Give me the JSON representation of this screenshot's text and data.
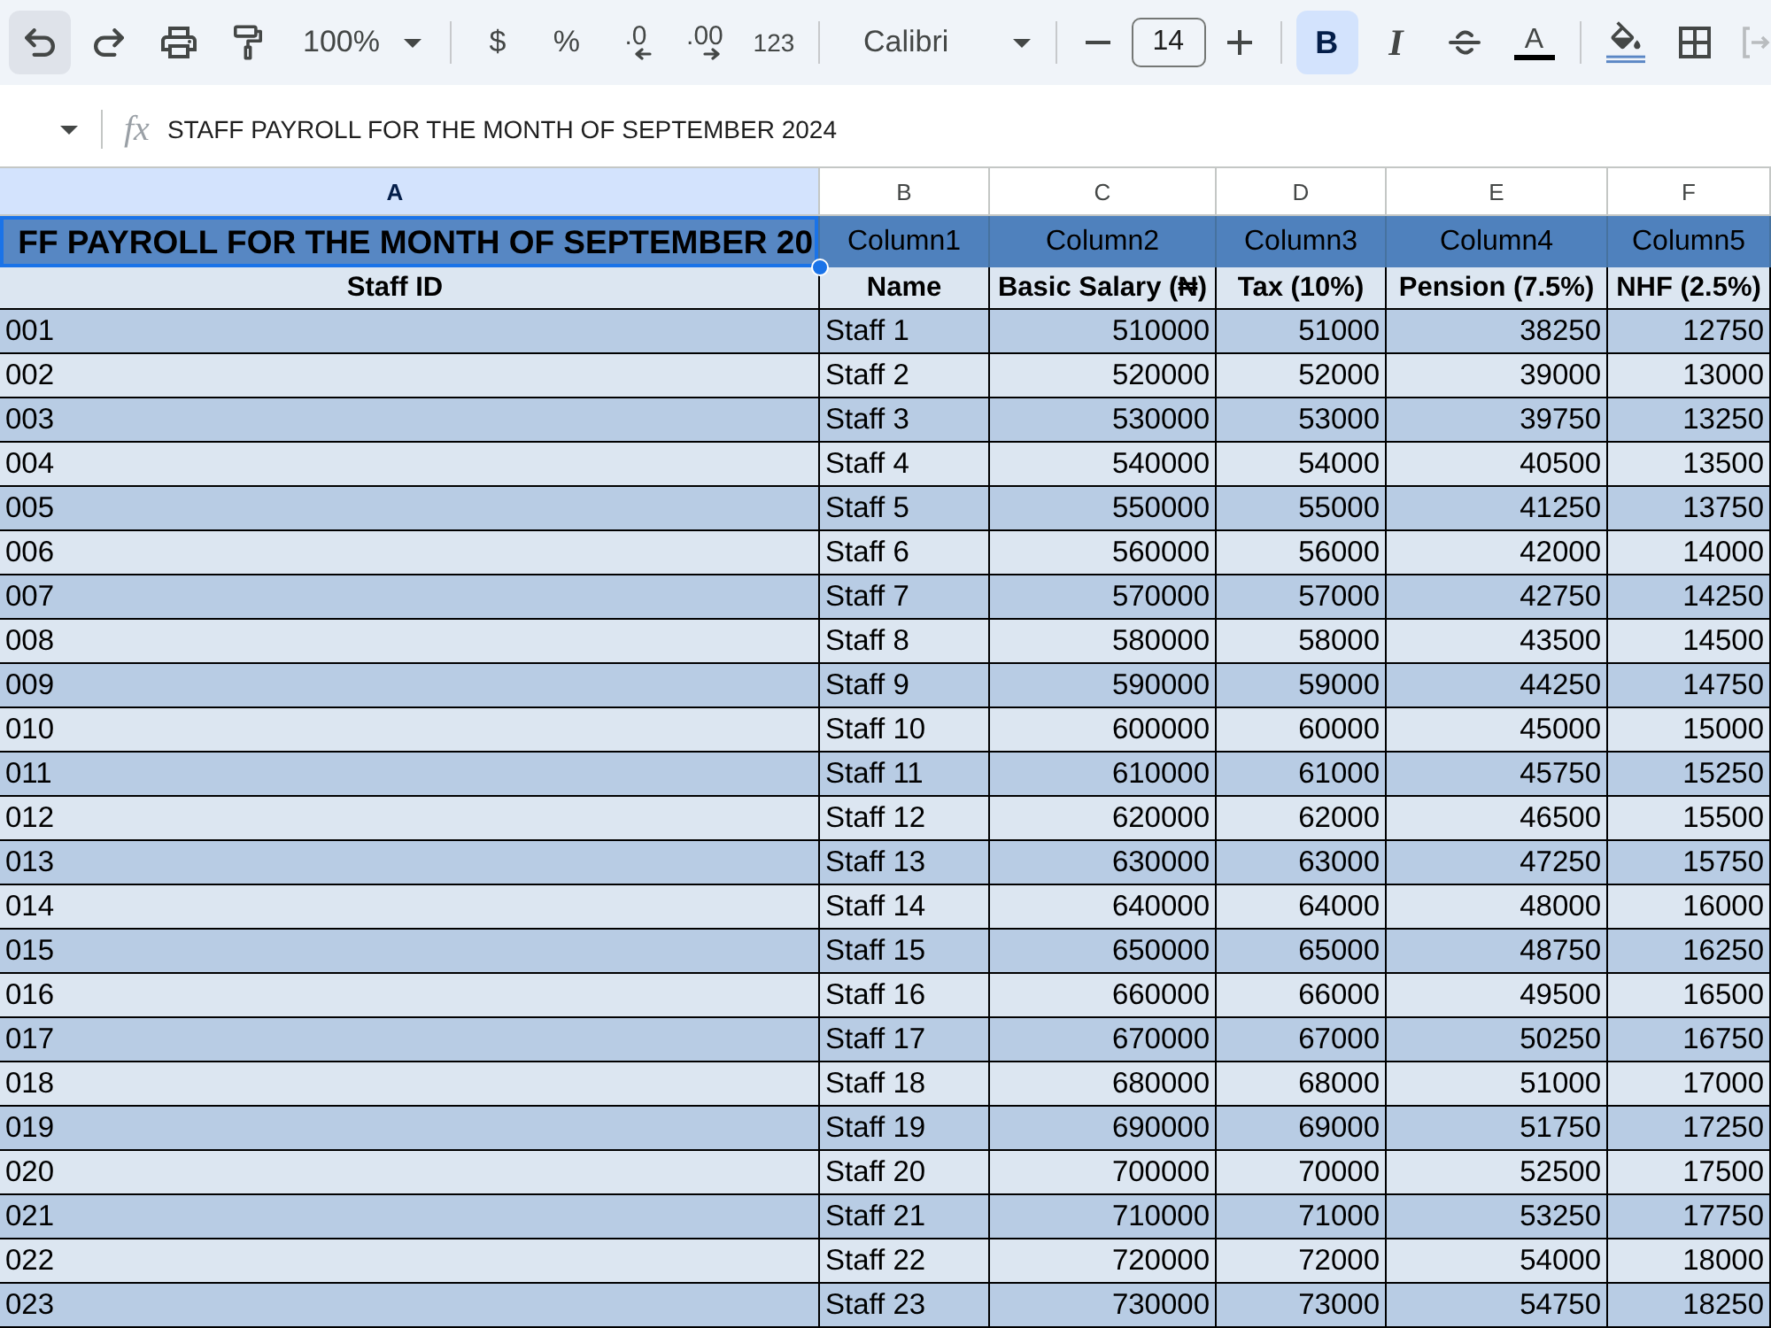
{
  "toolbar": {
    "groups": [
      {
        "items": [
          {
            "kind": "undo",
            "hovered": true
          },
          {
            "kind": "redo",
            "hovered": false
          },
          {
            "kind": "print",
            "hovered": false
          },
          {
            "kind": "paint_format",
            "hovered": false
          },
          {
            "kind": "zoom",
            "label": "100%",
            "hovered": false
          }
        ]
      },
      {
        "items": [
          {
            "kind": "currency",
            "label": "$",
            "hovered": false
          },
          {
            "kind": "percent",
            "label": "%",
            "hovered": false
          },
          {
            "kind": "decimal_decrease",
            "label": ".0",
            "hovered": false
          },
          {
            "kind": "decimal_increase",
            "label": ".00",
            "hovered": false
          },
          {
            "kind": "number_format",
            "label": "123",
            "hovered": false
          }
        ]
      },
      {
        "items": [
          {
            "kind": "font",
            "label": "Calibri",
            "hovered": false
          }
        ]
      },
      {
        "items": [
          {
            "kind": "size_decrease",
            "hovered": false
          },
          {
            "kind": "font_size",
            "value": "14",
            "hovered": false
          },
          {
            "kind": "size_increase",
            "hovered": false
          }
        ]
      },
      {
        "items": [
          {
            "kind": "bold",
            "label": "B",
            "hovered": false,
            "pressed": true
          },
          {
            "kind": "italic",
            "label": "I",
            "hovered": false,
            "pressed": false
          },
          {
            "kind": "strikethrough",
            "hovered": false,
            "pressed": false
          },
          {
            "kind": "text_color",
            "label": "A",
            "hovered": false,
            "pressed": false
          }
        ]
      },
      {
        "items": [
          {
            "kind": "fill_color",
            "hovered": false
          },
          {
            "kind": "borders",
            "hovered": false
          },
          {
            "kind": "merge",
            "hovered": false
          }
        ]
      }
    ]
  },
  "formula_bar": {
    "label": "fx",
    "formula": "STAFF PAYROLL FOR THE MONTH OF SEPTEMBER 2024"
  },
  "sheet": {
    "columns": [
      {
        "letter": "A",
        "selected": true
      },
      {
        "letter": "B",
        "selected": false
      },
      {
        "letter": "C",
        "selected": false
      },
      {
        "letter": "D",
        "selected": false
      },
      {
        "letter": "E",
        "selected": false
      },
      {
        "letter": "F",
        "selected": false
      }
    ],
    "title_row": [
      {
        "kind": "title",
        "text": "FF PAYROLL FOR THE MONTH OF SEPTEMBER 20",
        "selected": true
      },
      {
        "kind": "name",
        "text": "Column1",
        "selected": false
      },
      {
        "kind": "name",
        "text": "Column2",
        "selected": false
      },
      {
        "kind": "name",
        "text": "Column3",
        "selected": false
      },
      {
        "kind": "name",
        "text": "Column4",
        "selected": false
      },
      {
        "kind": "name",
        "text": "Column5",
        "selected": false
      }
    ],
    "header_row": [
      "Staff ID",
      "Name",
      "Basic Salary (₦)",
      "Tax (10%)",
      "Pension (7.5%)",
      "NHF (2.5%)"
    ],
    "rows": [
      [
        "001",
        "Staff 1",
        "510000",
        "51000",
        "38250",
        "12750"
      ],
      [
        "002",
        "Staff 2",
        "520000",
        "52000",
        "39000",
        "13000"
      ],
      [
        "003",
        "Staff 3",
        "530000",
        "53000",
        "39750",
        "13250"
      ],
      [
        "004",
        "Staff 4",
        "540000",
        "54000",
        "40500",
        "13500"
      ],
      [
        "005",
        "Staff 5",
        "550000",
        "55000",
        "41250",
        "13750"
      ],
      [
        "006",
        "Staff 6",
        "560000",
        "56000",
        "42000",
        "14000"
      ],
      [
        "007",
        "Staff 7",
        "570000",
        "57000",
        "42750",
        "14250"
      ],
      [
        "008",
        "Staff 8",
        "580000",
        "58000",
        "43500",
        "14500"
      ],
      [
        "009",
        "Staff 9",
        "590000",
        "59000",
        "44250",
        "14750"
      ],
      [
        "010",
        "Staff 10",
        "600000",
        "60000",
        "45000",
        "15000"
      ],
      [
        "011",
        "Staff 11",
        "610000",
        "61000",
        "45750",
        "15250"
      ],
      [
        "012",
        "Staff 12",
        "620000",
        "62000",
        "46500",
        "15500"
      ],
      [
        "013",
        "Staff 13",
        "630000",
        "63000",
        "47250",
        "15750"
      ],
      [
        "014",
        "Staff 14",
        "640000",
        "64000",
        "48000",
        "16000"
      ],
      [
        "015",
        "Staff 15",
        "650000",
        "65000",
        "48750",
        "16250"
      ],
      [
        "016",
        "Staff 16",
        "660000",
        "66000",
        "49500",
        "16500"
      ],
      [
        "017",
        "Staff 17",
        "670000",
        "67000",
        "50250",
        "16750"
      ],
      [
        "018",
        "Staff 18",
        "680000",
        "68000",
        "51000",
        "17000"
      ],
      [
        "019",
        "Staff 19",
        "690000",
        "69000",
        "51750",
        "17250"
      ],
      [
        "020",
        "Staff 20",
        "700000",
        "70000",
        "52500",
        "17500"
      ],
      [
        "021",
        "Staff 21",
        "710000",
        "71000",
        "53250",
        "17750"
      ],
      [
        "022",
        "Staff 22",
        "720000",
        "72000",
        "54000",
        "18000"
      ],
      [
        "023",
        "Staff 23",
        "730000",
        "73000",
        "54750",
        "18250"
      ]
    ]
  }
}
